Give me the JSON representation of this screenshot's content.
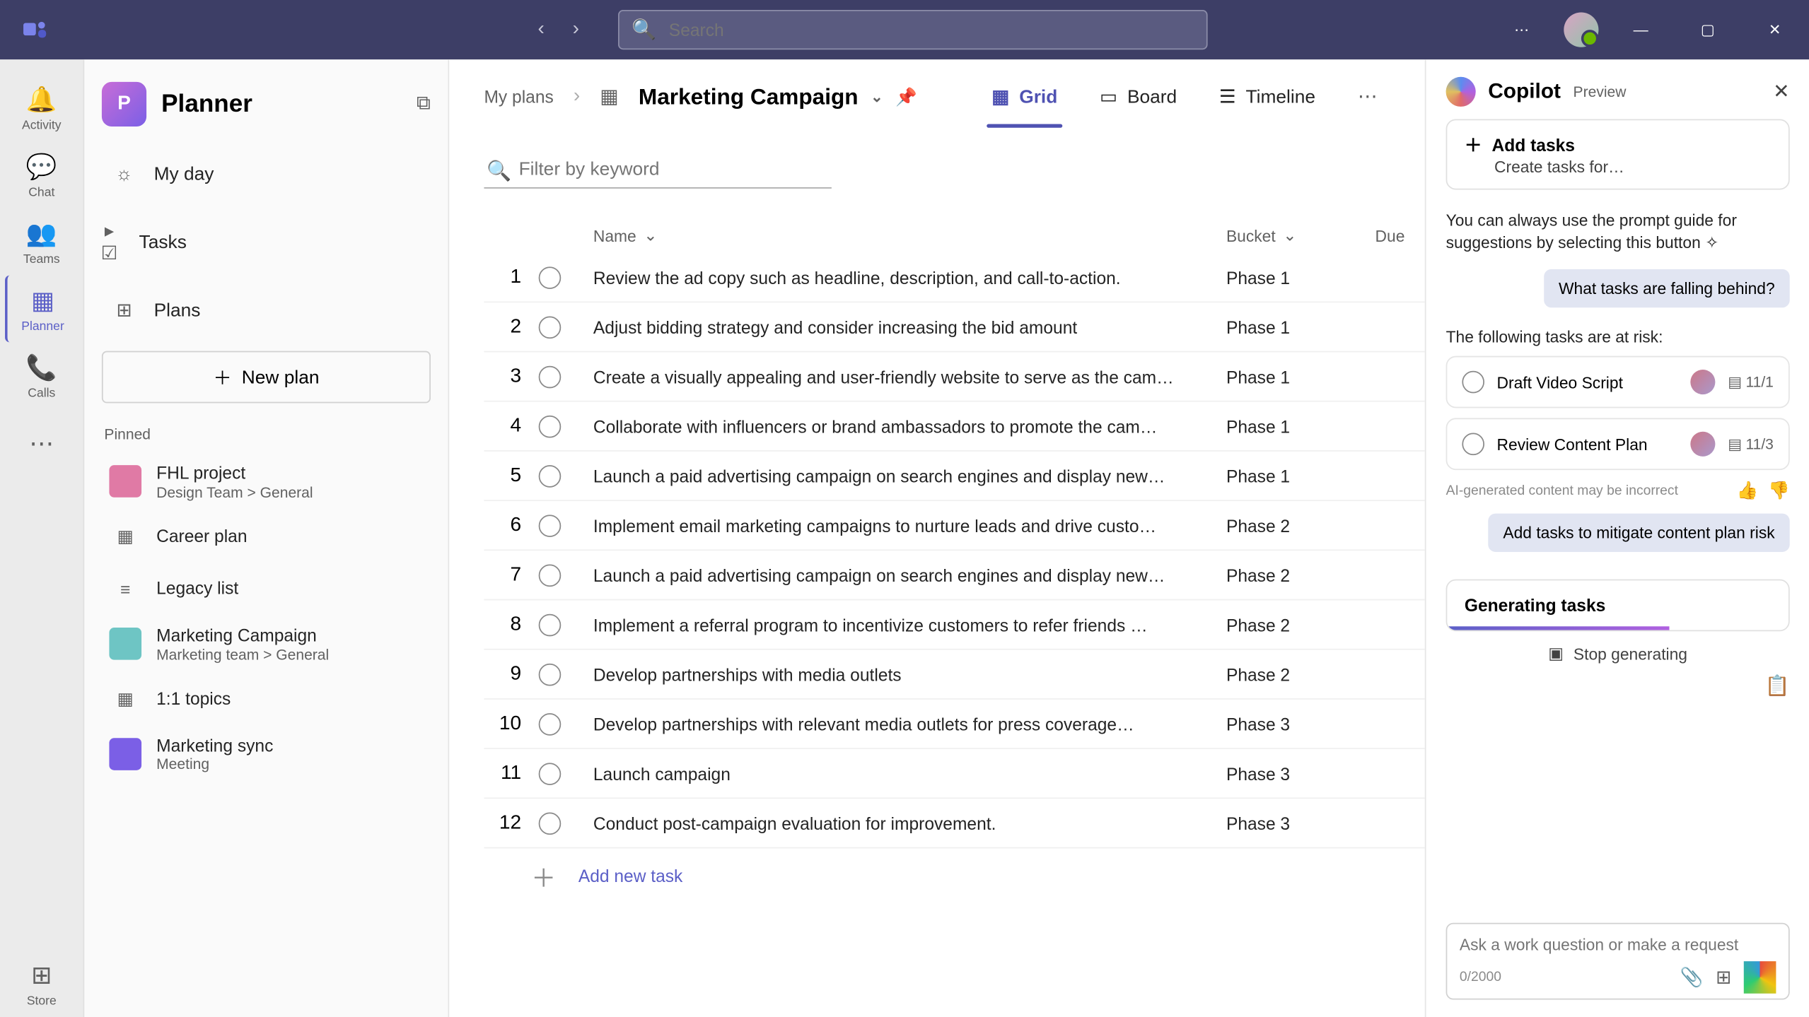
{
  "titlebar": {
    "search_placeholder": "Search"
  },
  "appRail": {
    "items": [
      {
        "icon": "🔔",
        "label": "Activity"
      },
      {
        "icon": "💬",
        "label": "Chat"
      },
      {
        "icon": "👥",
        "label": "Teams"
      },
      {
        "icon": "▦",
        "label": "Planner",
        "selected": true
      },
      {
        "icon": "📞",
        "label": "Calls"
      },
      {
        "icon": "⋯",
        "label": ""
      }
    ],
    "store": {
      "icon": "⊞",
      "label": "Store"
    }
  },
  "plannerNav": {
    "title": "Planner",
    "myDay": "My day",
    "tasks": "Tasks",
    "plans": "Plans",
    "newPlan": "New plan",
    "pinnedLabel": "Pinned",
    "pinned": [
      {
        "title": "FHL project",
        "sub": "Design Team > General",
        "color": "#e07aa5"
      },
      {
        "title": "Career plan",
        "sub": "",
        "icon": "▦",
        "mono": true
      },
      {
        "title": "Legacy list",
        "sub": "",
        "icon": "≡",
        "mono": true
      },
      {
        "title": "Marketing Campaign",
        "sub": "Marketing team > General",
        "color": "#6ec5c4"
      },
      {
        "title": "1:1 topics",
        "sub": "",
        "icon": "▦",
        "mono": true
      },
      {
        "title": "Marketing sync",
        "sub": "Meeting",
        "color": "#7b5fe6"
      }
    ]
  },
  "planToolbar": {
    "myPlans": "My plans",
    "planName": "Marketing Campaign",
    "views": [
      {
        "icon": "▦",
        "label": "Grid",
        "active": true
      },
      {
        "icon": "▭",
        "label": "Board"
      },
      {
        "icon": "☰",
        "label": "Timeline"
      }
    ]
  },
  "filter": {
    "placeholder": "Filter by keyword"
  },
  "table": {
    "headers": {
      "name": "Name",
      "bucket": "Bucket",
      "due": "Due"
    },
    "rows": [
      {
        "n": 1,
        "name": "Review the ad copy such as headline, description, and call-to-action.",
        "bucket": "Phase 1"
      },
      {
        "n": 2,
        "name": "Adjust bidding strategy and consider increasing the bid amount",
        "bucket": "Phase 1"
      },
      {
        "n": 3,
        "name": "Create a visually appealing and user-friendly website to serve as the cam…",
        "bucket": "Phase 1"
      },
      {
        "n": 4,
        "name": "Collaborate with influencers or brand ambassadors to promote the cam…",
        "bucket": "Phase 1"
      },
      {
        "n": 5,
        "name": "Launch a paid advertising campaign on search engines and display new…",
        "bucket": "Phase 1"
      },
      {
        "n": 6,
        "name": "Implement email marketing campaigns to nurture leads and drive custo…",
        "bucket": "Phase 2"
      },
      {
        "n": 7,
        "name": "Launch a paid advertising campaign on search engines and display new…",
        "bucket": "Phase 2"
      },
      {
        "n": 8,
        "name": "Implement a referral program to incentivize customers to refer friends …",
        "bucket": "Phase 2"
      },
      {
        "n": 9,
        "name": "Develop partnerships with media outlets",
        "bucket": "Phase 2"
      },
      {
        "n": 10,
        "name": "Develop partnerships with relevant media outlets for press coverage…",
        "bucket": "Phase 3"
      },
      {
        "n": 11,
        "name": "Launch campaign",
        "bucket": "Phase 3"
      },
      {
        "n": 12,
        "name": "Conduct post-campaign evaluation for improvement.",
        "bucket": "Phase 3"
      }
    ],
    "addTask": "Add new task"
  },
  "copilot": {
    "title": "Copilot",
    "preview": "Preview",
    "addTasksTitle": "Add tasks",
    "addTasksSub": "Create tasks for…",
    "guideText": "You can always use the prompt guide for suggestions by selecting this button ✧",
    "userQ": "What tasks are falling behind?",
    "atRisk": "The following tasks are at risk:",
    "risks": [
      {
        "name": "Draft Video Script",
        "date": "11/1"
      },
      {
        "name": "Review Content Plan",
        "date": "11/3"
      }
    ],
    "aiNote": "AI-generated content may be incorrect",
    "userQ2": "Add tasks to mitigate content plan risk",
    "generating": "Generating tasks",
    "stop": "Stop generating",
    "inputPlaceholder": "Ask a work question or make a request",
    "charCount": "0/2000"
  }
}
